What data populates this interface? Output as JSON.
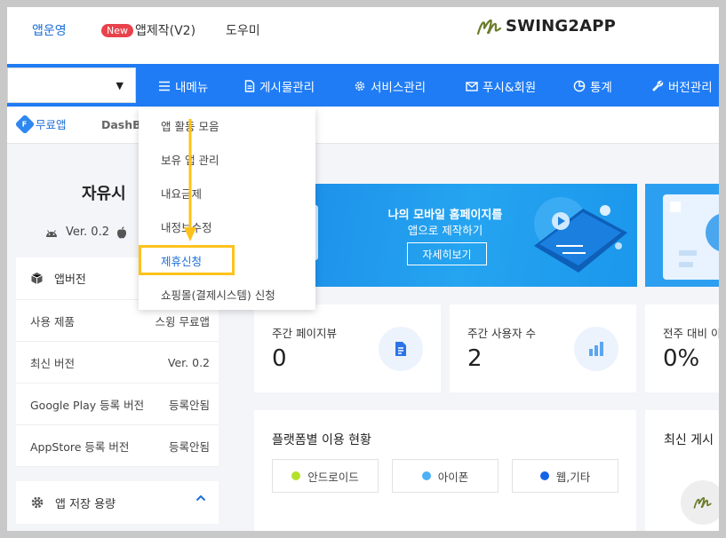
{
  "topbar": {
    "app_ops": "앱운영",
    "new_badge": "New",
    "app_make": "앱제작(V2)",
    "help": "도우미",
    "logo": "SWING2APP"
  },
  "nav": {
    "items": [
      {
        "label": "내메뉴",
        "icon": "hamburger-icon"
      },
      {
        "label": "게시물관리",
        "icon": "document-icon"
      },
      {
        "label": "서비스관리",
        "icon": "gear-icon"
      },
      {
        "label": "푸시&회원",
        "icon": "mail-icon"
      },
      {
        "label": "통계",
        "icon": "pie-chart-icon"
      },
      {
        "label": "버전관리",
        "icon": "wrench-icon"
      }
    ],
    "caret": "▼"
  },
  "subbar": {
    "plan_letter": "F",
    "plan": "무료앱",
    "dashboard": "DashBo"
  },
  "sidebar": {
    "app_title": "자유시",
    "version": "Ver. 0.2",
    "info_header": "앱버전",
    "rows": [
      {
        "label": "사용 제품",
        "value": "스윙 무료앱"
      },
      {
        "label": "최신 버전",
        "value": "Ver. 0.2"
      },
      {
        "label": "Google Play 등록 버전",
        "value": "등록안됨"
      },
      {
        "label": "AppStore 등록 버전",
        "value": "등록안됨"
      }
    ],
    "storage": "앱 저장 용량",
    "storage_chevron": "^"
  },
  "banner": {
    "title": "나의 모바일 홈페이지를",
    "subtitle": "앱으로 제작하기",
    "button": "자세히보기"
  },
  "stats": [
    {
      "label": "주간 페이지뷰",
      "value": "0",
      "icon": "page-icon"
    },
    {
      "label": "주간 사용자 수",
      "value": "2",
      "icon": "bar-chart-icon"
    },
    {
      "label": "전주 대비 이",
      "value": "0%"
    }
  ],
  "platform": {
    "title": "플랫폼별 이용 현황",
    "chips": [
      {
        "label": "안드로이드",
        "color": "#b5e02a"
      },
      {
        "label": "아이폰",
        "color": "#4db1f5"
      },
      {
        "label": "웹,기타",
        "color": "#1463e6"
      }
    ]
  },
  "recent": {
    "title": "최신 게시"
  },
  "dropdown": {
    "items": [
      "앱 활동 모음",
      "보유 앱 관리",
      "내요금제",
      "내정보수정",
      "제휴신청",
      "쇼핑몰(결제시스템) 신청"
    ]
  }
}
